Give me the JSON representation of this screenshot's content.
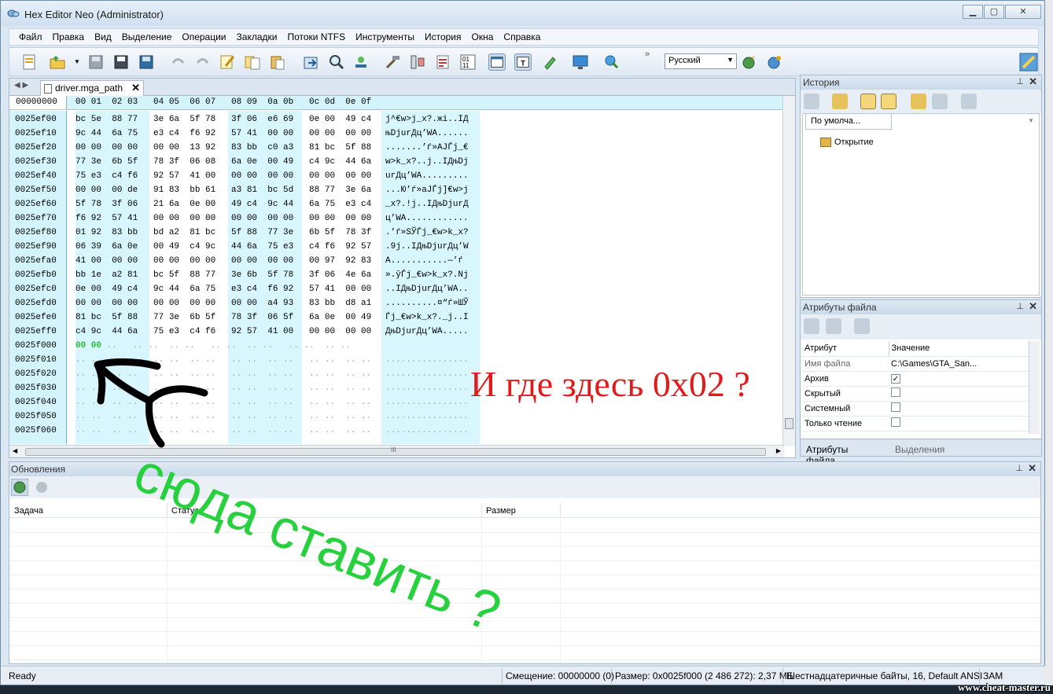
{
  "window": {
    "title": "Hex Editor Neo (Administrator)"
  },
  "menu": [
    "Файл",
    "Правка",
    "Вид",
    "Выделение",
    "Операции",
    "Закладки",
    "Потоки NTFS",
    "Инструменты",
    "История",
    "Окна",
    "Справка"
  ],
  "toolbar": {
    "language": "Русский",
    "overflow": "»"
  },
  "editor": {
    "tab_label": "driver.mga_path",
    "header_addr": "00000000",
    "header_cols": "00 01  02 03   04 05  06 07   08 09  0a 0b   0c 0d  0e 0f",
    "addresses": [
      "0025ef00",
      "0025ef10",
      "0025ef20",
      "0025ef30",
      "0025ef40",
      "0025ef50",
      "0025ef60",
      "0025ef70",
      "0025ef80",
      "0025ef90",
      "0025efa0",
      "0025efb0",
      "0025efc0",
      "0025efd0",
      "0025efe0",
      "0025eff0",
      "0025f000",
      "0025f010",
      "0025f020",
      "0025f030",
      "0025f040",
      "0025f050",
      "0025f060"
    ],
    "hex_rows": [
      "bc 5e  88 77   3e 6a  5f 78   3f 06  e6 69   0e 00  49 c4",
      "9c 44  6a 75   e3 c4  f6 92   57 41  00 00   00 00  00 00",
      "00 00  00 00   00 00  13 92   83 bb  c0 a3   81 bc  5f 88",
      "77 3e  6b 5f   78 3f  06 08   6a 0e  00 49   c4 9c  44 6a",
      "75 e3  c4 f6   92 57  41 00   00 00  00 00   00 00  00 00",
      "00 00  00 de   91 83  bb 61   a3 81  bc 5d   88 77  3e 6a",
      "5f 78  3f 06   21 6a  0e 00   49 c4  9c 44   6a 75  e3 c4",
      "f6 92  57 41   00 00  00 00   00 00  00 00   00 00  00 00",
      "01 92  83 bb   bd a2  81 bc   5f 88  77 3e   6b 5f  78 3f",
      "06 39  6a 0e   00 49  c4 9c   44 6a  75 e3   c4 f6  92 57",
      "41 00  00 00   00 00  00 00   00 00  00 00   00 97  92 83",
      "bb 1e  a2 81   bc 5f  88 77   3e 6b  5f 78   3f 06  4e 6a",
      "0e 00  49 c4   9c 44  6a 75   e3 c4  f6 92   57 41  00 00",
      "00 00  00 00   00 00  00 00   00 00  a4 93   83 bb  d8 a1",
      "81 bc  5f 88   77 3e  6b 5f   78 3f  06 5f   6a 0e  00 49",
      "c4 9c  44 6a   75 e3  c4 f6   92 57  41 00   00 00  00 00"
    ],
    "new_row_bytes": "00 00",
    "empty_row": ".. ..  .. ..   .. ..  .. ..   .. ..  .. ..   .. ..  .. ..",
    "empty_row_partial": "..   .. ..  .. ..   .. ..  .. ..   .. ..  .. ..",
    "text_rows": [
      "j^€w>j_x?.жi..IД",
      "њDjurДц’WA......",
      ".......’ѓ»АЈЃј_€",
      "w>k_x?..j..IДњDj",
      "urДц’WA.........",
      "...Ю’ѓ»aЈЃј]€w>j",
      "_x?.!j..IДњDjurД",
      "ц’WA............",
      ".’ѓ»ЅЎЃј_€w>k_x?",
      ".9j..IДњDjurДц’W",
      "A...........—’ѓ",
      "».ўЃј_€w>k_x?.Nj",
      "..IДњDjurДц’WA..",
      "..........¤“ѓ»ШЎ",
      "Ѓј_€w>k_x?._j..I",
      "ДњDjurДц’WA....."
    ],
    "text_empty": "................",
    "hscroll_grip": "III"
  },
  "history": {
    "title": "История",
    "tab": "По умолча...",
    "node": "Открытие"
  },
  "attributes": {
    "title": "Атрибуты файла",
    "col_attr": "Атрибут",
    "col_value": "Значение",
    "rows": [
      {
        "name": "Имя файла",
        "value": "C:\\Games\\GTA_San..."
      },
      {
        "name": "Архив",
        "checked": true
      },
      {
        "name": "Скрытый",
        "checked": false
      },
      {
        "name": "Системный",
        "checked": false
      },
      {
        "name": "Только чтение",
        "checked": false
      }
    ],
    "tab1": "Атрибуты файла",
    "tab2": "Выделения"
  },
  "updates": {
    "title": "Обновления",
    "col_task": "Задача",
    "col_status": "Статус",
    "col_size": "Размер"
  },
  "status": {
    "ready": "Ready",
    "offset": "Смещение: 00000000 (0)",
    "size": "Размер: 0x0025f000 (2 486 272): 2,37 МБ",
    "mode": "Шестнадцатеричные байты, 16, Default ANSI",
    "ins": "ЗАМ"
  },
  "annotations": {
    "red": "И где здесь 0x02 ?",
    "green": "сюда ставить ?"
  },
  "watermark": "www.cheat-master.ru",
  "colors": {
    "red_note": "#e21a1a",
    "green_note": "#27d13d",
    "hex_bg": "#d3f4fb"
  }
}
